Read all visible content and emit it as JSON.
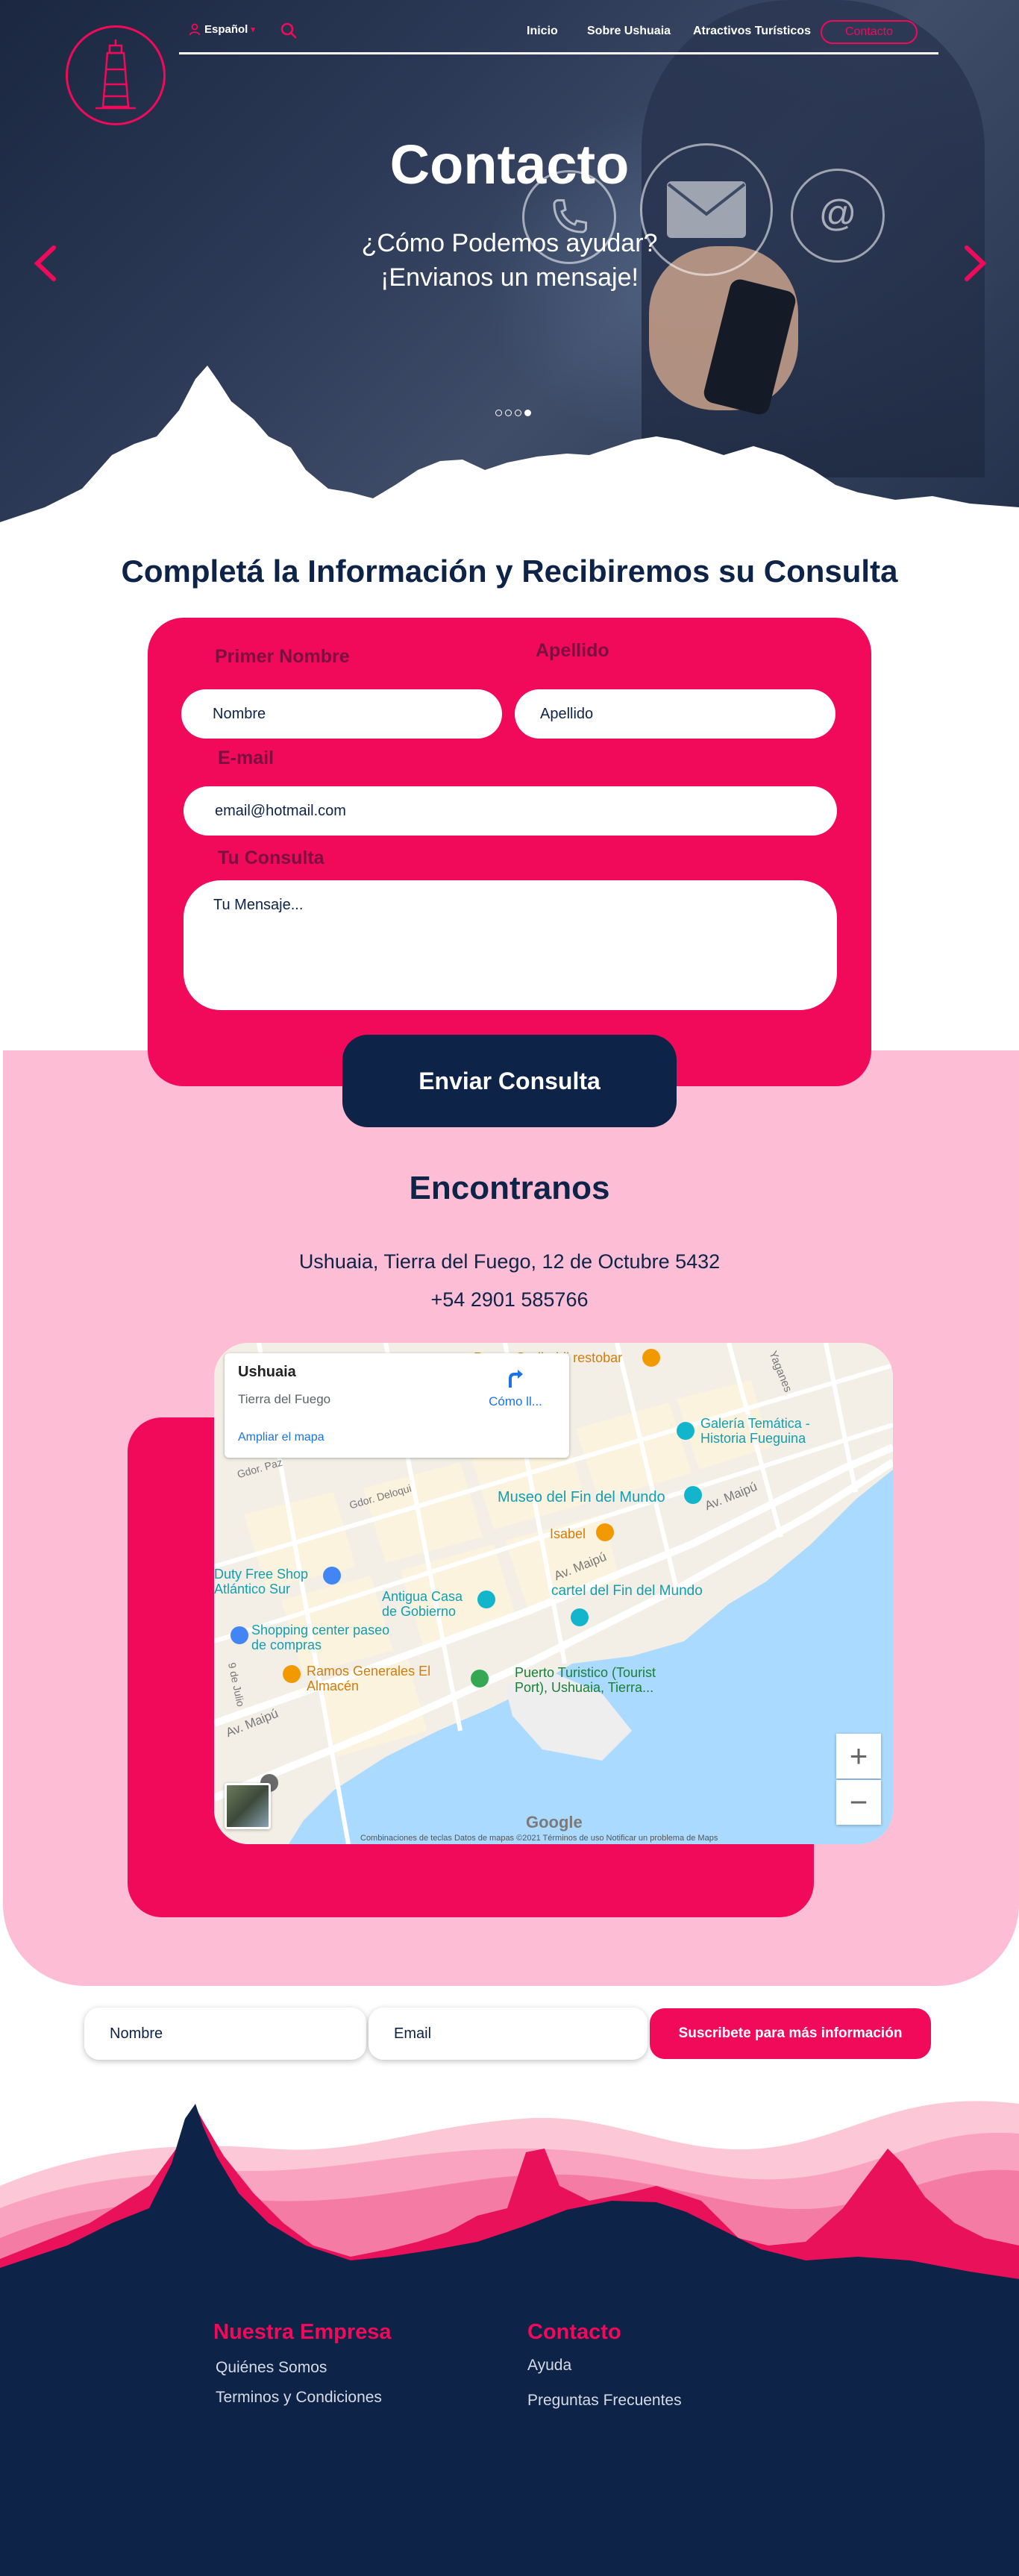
{
  "colors": {
    "primary": "#f20a5a",
    "navy": "#0d2348",
    "light_pink": "#fdbdd5"
  },
  "header": {
    "language": "Español",
    "nav": [
      "Inicio",
      "Sobre Ushuaia",
      "Atractivos Turísticos"
    ],
    "cta": "Contacto",
    "icons": [
      "lighthouse-logo",
      "user-icon",
      "search-icon"
    ]
  },
  "hero": {
    "title": "Contacto",
    "subtitle_line1": "¿Cómo Podemos ayudar?",
    "subtitle_line2": "¡Envianos un mensaje!",
    "carousel_active_index": 4,
    "carousel_count": 4
  },
  "form": {
    "heading": "Completá la Información y Recibiremos su Consulta",
    "first_name_label": "Primer Nombre",
    "first_name_value": "Nombre",
    "last_name_label": "Apellido",
    "last_name_value": "Apellido",
    "email_label": "E-mail",
    "email_value": "email@hotmail.com",
    "query_label": "Tu Consulta",
    "query_value": "Tu Mensaje...",
    "submit": "Enviar Consulta"
  },
  "location": {
    "heading": "Encontranos",
    "address": "Ushuaia, Tierra del Fuego, 12 de Octubre 5432",
    "phone": "+54 2901 585766"
  },
  "map": {
    "place": "Ushuaia",
    "region": "Tierra del Fuego",
    "directions": "Cómo ll...",
    "enlarge": "Ampliar el mapa",
    "labels": {
      "restobar": "Paseo Garibaldi restobar",
      "galeria": "Galería Temática - Historia Fueguina",
      "museo": "Museo del Fin del Mundo",
      "isabel": "Isabel",
      "duty_free": "Duty Free Shop Atlántico Sur",
      "casa_gobierno": "Antigua Casa de Gobierno",
      "cartel": "cartel del Fin del Mundo",
      "shopping": "Shopping center paseo de compras",
      "ramos": "Ramos Generales El Almacén",
      "puerto": "Puerto Turistico (Tourist Port), Ushuaia, Tierra...",
      "av_maipu": "Av. Maipú",
      "gdor_deloqui": "Gdor. Deloqui",
      "gdor_paz": "Gdor. Paz",
      "yaganes": "Yaganes",
      "nueve_julio": "9 de Julio",
      "google": "Google",
      "footer_text": "Combinaciones de teclas   Datos de mapas ©2021   Términos de uso   Notificar un problema de Maps"
    }
  },
  "newsletter": {
    "name_placeholder": "Nombre",
    "email_placeholder": "Email",
    "button": "Suscribete para más información"
  },
  "footer": {
    "col1_title": "Nuestra Empresa",
    "col1_links": [
      "Quiénes Somos",
      "Terminos y Condiciones"
    ],
    "col2_title": "Contacto",
    "col2_links": [
      "Ayuda",
      "Preguntas Frecuentes"
    ]
  }
}
